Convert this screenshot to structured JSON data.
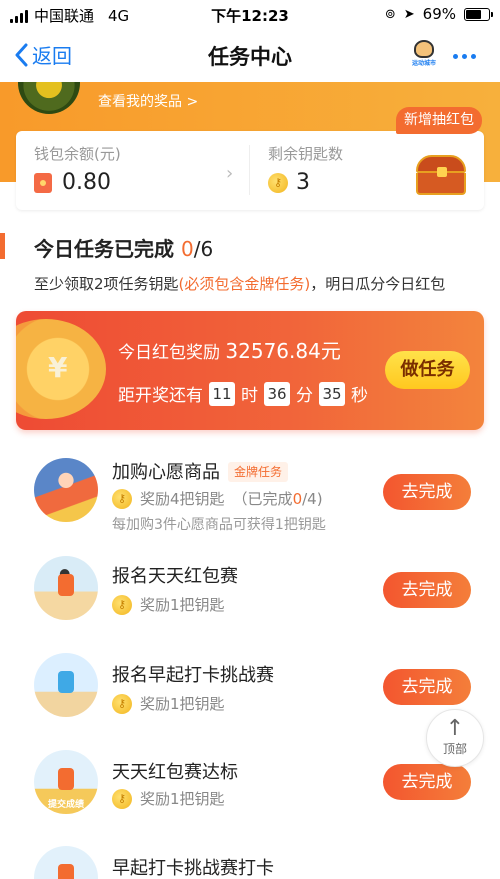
{
  "status_bar": {
    "carrier": "中国联通",
    "network": "4G",
    "time": "下午12:23",
    "battery_percent": "69%",
    "battery_level": 0.69
  },
  "nav": {
    "back_label": "返回",
    "title": "任务中心",
    "logo_text": "运动城市"
  },
  "header": {
    "view_prizes": "查看我的奖品 >"
  },
  "wallet": {
    "balance_label": "钱包余额(元)",
    "balance_value": "0.80",
    "keys_label": "剩余钥匙数",
    "keys_value": "3",
    "new_badge": "新增抽红包"
  },
  "today": {
    "title": "今日任务已完成",
    "completed": "0",
    "total": "/6",
    "desc_prefix": "至少领取2项任务钥匙",
    "desc_highlight": "(必须包含金牌任务)",
    "desc_suffix": "，明日瓜分今日红包"
  },
  "reward": {
    "coin_symbol": "¥",
    "label": "今日红包奖励",
    "amount": "32576.84元",
    "countdown_prefix": "距开奖还有",
    "hours": "11",
    "h_unit": "时",
    "minutes": "36",
    "m_unit": "分",
    "seconds": "35",
    "s_unit": "秒",
    "button": "做任务"
  },
  "tasks": [
    {
      "title": "加购心愿商品",
      "tag": "金牌任务",
      "reward": "奖励4把钥匙",
      "progress_prefix": "（已完成",
      "progress_done": "0",
      "progress_suffix": "/4)",
      "note": "每加购3件心愿商品可获得1把钥匙",
      "button": "去完成"
    },
    {
      "title": "报名天天红包赛",
      "reward": "奖励1把钥匙",
      "button": "去完成"
    },
    {
      "title": "报名早起打卡挑战赛",
      "reward": "奖励1把钥匙",
      "button": "去完成"
    },
    {
      "title": "天天红包赛达标",
      "reward": "奖励1把钥匙",
      "avatar_badge": "提交成绩",
      "button": "去完成"
    },
    {
      "title": "早起打卡挑战赛打卡"
    }
  ],
  "back_to_top": {
    "arrow": "↑",
    "label": "顶部"
  },
  "icons": [
    "back-chevron-icon",
    "red-packet-icon",
    "key-coin-icon",
    "treasure-chest-icon",
    "coin-yen-icon",
    "more-dots-icon",
    "arrow-up-icon"
  ],
  "colors": {
    "accent": "#f36c30",
    "link_blue": "#1a7cf0",
    "header_orange": "#f89a2a",
    "button_yellow": "#ffc81f"
  }
}
